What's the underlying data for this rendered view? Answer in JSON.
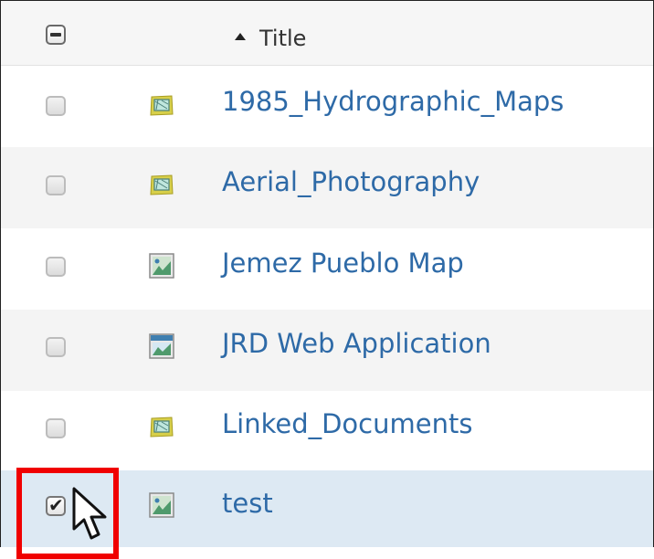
{
  "header": {
    "title_column_label": "Title",
    "sort_icon": "sort-ascending-icon",
    "select_all_icon": "checkbox-indeterminate-icon"
  },
  "items": [
    {
      "title": "1985_Hydrographic_Maps",
      "icon": "map-package-icon",
      "checked": false
    },
    {
      "title": "Aerial_Photography",
      "icon": "map-package-icon",
      "checked": false
    },
    {
      "title": "Jemez Pueblo Map",
      "icon": "web-map-icon",
      "checked": false
    },
    {
      "title": "JRD Web Application",
      "icon": "web-application-icon",
      "checked": false
    },
    {
      "title": "Linked_Documents",
      "icon": "map-package-icon",
      "checked": false
    },
    {
      "title": "test",
      "icon": "web-map-icon",
      "checked": true
    }
  ],
  "colors": {
    "link": "#2e6aa7",
    "selected_row": "#dde9f3",
    "highlight": "#f00000"
  },
  "cursor_icon": "mouse-pointer-icon"
}
